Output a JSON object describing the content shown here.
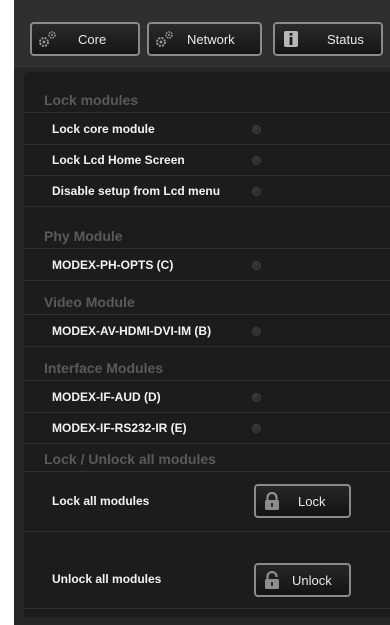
{
  "tabs": [
    {
      "label": "Core",
      "icon": "gears-icon"
    },
    {
      "label": "Network",
      "icon": "gears-icon"
    },
    {
      "label": "Status",
      "icon": "info-icon"
    }
  ],
  "sections": {
    "lock_modules": {
      "title": "Lock modules",
      "items": [
        {
          "label": "Lock core module"
        },
        {
          "label": "Lock Lcd Home Screen"
        },
        {
          "label": "Disable setup from Lcd menu"
        }
      ]
    },
    "phy_module": {
      "title": "Phy Module",
      "items": [
        {
          "label": "MODEX-PH-OPTS (C)"
        }
      ]
    },
    "video_module": {
      "title": "Video Module",
      "items": [
        {
          "label": "MODEX-AV-HDMI-DVI-IM (B)"
        }
      ]
    },
    "interface_modules": {
      "title": "Interface Modules",
      "items": [
        {
          "label": "MODEX-IF-AUD (D)"
        },
        {
          "label": "MODEX-IF-RS232-IR (E)"
        }
      ]
    },
    "lock_unlock_all": {
      "title": "Lock / Unlock all modules",
      "lock_label": "Lock all modules",
      "lock_button": "Lock",
      "unlock_label": "Unlock all modules",
      "unlock_button": "Unlock"
    }
  },
  "colors": {
    "background": "#262626",
    "panel": "#1c1c1c",
    "section_title": "#5a5a5a",
    "text": "#f2f2f2",
    "button_border": "#8a8a8a"
  }
}
